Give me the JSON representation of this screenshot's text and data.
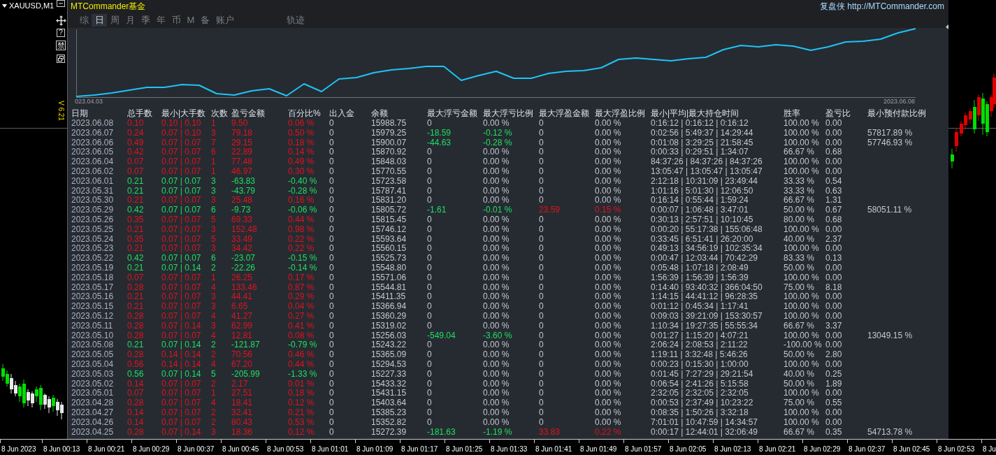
{
  "chart_window": {
    "symbol": "XAUUSD,M1",
    "time_axis": [
      "8 Jun 2023",
      "8 Jun 00:13",
      "8 Jun 00:21",
      "8 Jun 00:29",
      "8 Jun 00:37",
      "8 Jun 00:45",
      "8 Jun 00:53",
      "8 Jun 01:01",
      "8 Jun 01:09",
      "8 Jun 01:17",
      "8 Jun 01:25",
      "8 Jun 01:33",
      "8 Jun 01:41",
      "8 Jun 01:49",
      "8 Jun 01:57",
      "8 Jun 02:05",
      "8 Jun 02:13",
      "8 Jun 02:21",
      "8 Jun 02:29",
      "8 Jun 02:37",
      "8 Jun 02:45",
      "8 Jun 02:53",
      "8 Ju"
    ]
  },
  "side_toolbar": {
    "help_label": "?",
    "ban_label": "禁",
    "version": "V 6.21"
  },
  "panel": {
    "title": "MTCommander基金",
    "link": "复盘侠 http://MTCommander.com",
    "tabs": [
      {
        "label": "综",
        "selected": false
      },
      {
        "label": "日",
        "selected": true
      },
      {
        "label": "周",
        "selected": false
      },
      {
        "label": "月",
        "selected": false
      },
      {
        "label": "季",
        "selected": false
      },
      {
        "label": "年",
        "selected": false
      },
      {
        "label": "币",
        "selected": false
      },
      {
        "label": "M",
        "selected": false
      },
      {
        "label": "备",
        "selected": false
      },
      {
        "label": "账户",
        "selected": false
      }
    ],
    "side_tabs": [
      {
        "label": "轨迹",
        "selected": false
      }
    ],
    "chart": {
      "start_label": "023.04.03",
      "end_label": "2023.06.08"
    }
  },
  "table": {
    "columns": [
      "日期",
      "总手数",
      "最小|大手数",
      "次数",
      "盈亏金额",
      "百分比%",
      "出入金",
      "余额",
      "最大浮亏金额",
      "最大浮亏比例",
      "最大浮盈金额",
      "最大浮盈比例",
      "最小|平均|最大持仓时间",
      "胜率",
      "盈亏比",
      "最小预付款比例"
    ],
    "rows": [
      {
        "cells": [
          "2023.06.08",
          "0.10",
          "0.10 | 0.10",
          "1",
          "9.50",
          "0.06 %",
          "0",
          "15988.75",
          "0",
          "0.00 %",
          "0",
          "0.00 %",
          "0:16:12 | 0:16:12 | 0:16:12",
          "100.00 %",
          "0.00"
        ],
        "profitable": true,
        "floating_loss": false,
        "floating_profit": false
      },
      {
        "cells": [
          "2023.06.07",
          "0.24",
          "0.07 | 0.10",
          "3",
          "79.18",
          "0.50 %",
          "0",
          "15979.25",
          "-18.59",
          "-0.12 %",
          "0",
          "0.00 %",
          "0:02:56 | 5:49:37 | 14:29:44",
          "100.00 %",
          "0.00",
          "57817.89 %"
        ],
        "profitable": true,
        "floating_loss": true,
        "floating_profit": false
      },
      {
        "cells": [
          "2023.06.06",
          "0.49",
          "0.07 | 0.07",
          "7",
          "29.15",
          "0.18 %",
          "0",
          "15900.07",
          "-44.63",
          "-0.28 %",
          "0",
          "0.00 %",
          "0:01:08 | 3:29:25 | 21:58:45",
          "100.00 %",
          "0.00",
          "57746.93 %"
        ],
        "profitable": true,
        "floating_loss": true,
        "floating_profit": false
      },
      {
        "cells": [
          "2023.06.05",
          "0.42",
          "0.07 | 0.07",
          "6",
          "22.89",
          "0.14 %",
          "0",
          "15870.92",
          "0",
          "0.00 %",
          "0",
          "0.00 %",
          "0:00:33 | 0:29:51 | 1:34:07",
          "66.67 %",
          "0.68"
        ],
        "profitable": true,
        "floating_loss": false,
        "floating_profit": false
      },
      {
        "cells": [
          "2023.06.04",
          "0.07",
          "0.07 | 0.07",
          "1",
          "77.48",
          "0.49 %",
          "0",
          "15848.03",
          "0",
          "0.00 %",
          "0",
          "0.00 %",
          "84:37:26 | 84:37:26 | 84:37:26",
          "100.00 %",
          "0.00"
        ],
        "profitable": true,
        "floating_loss": false,
        "floating_profit": false
      },
      {
        "cells": [
          "2023.06.02",
          "0.07",
          "0.07 | 0.07",
          "1",
          "46.97",
          "0.30 %",
          "0",
          "15770.55",
          "0",
          "0.00 %",
          "0",
          "0.00 %",
          "13:05:47 | 13:05:47 | 13:05:47",
          "100.00 %",
          "0.00"
        ],
        "profitable": true,
        "floating_loss": false,
        "floating_profit": false
      },
      {
        "cells": [
          "2023.06.01",
          "0.21",
          "0.07 | 0.07",
          "3",
          "-63.83",
          "-0.40 %",
          "0",
          "15723.58",
          "0",
          "0.00 %",
          "0",
          "0.00 %",
          "2:12:18 | 10:31:09 | 23:49:44",
          "33.33 %",
          "0.54"
        ],
        "profitable": false,
        "floating_loss": false,
        "floating_profit": false
      },
      {
        "cells": [
          "2023.05.31",
          "0.21",
          "0.07 | 0.07",
          "3",
          "-43.79",
          "-0.28 %",
          "0",
          "15787.41",
          "0",
          "0.00 %",
          "0",
          "0.00 %",
          "1:01:16 | 5:01:30 | 12:06:50",
          "33.33 %",
          "0.63"
        ],
        "profitable": false,
        "floating_loss": false,
        "floating_profit": false
      },
      {
        "cells": [
          "2023.05.30",
          "0.21",
          "0.07 | 0.07",
          "3",
          "25.48",
          "0.16 %",
          "0",
          "15831.20",
          "0",
          "0.00 %",
          "0",
          "0.00 %",
          "0:16:14 | 0:55:44 | 1:59:24",
          "66.67 %",
          "1.31"
        ],
        "profitable": true,
        "floating_loss": false,
        "floating_profit": false
      },
      {
        "cells": [
          "2023.05.29",
          "0.42",
          "0.07 | 0.07",
          "6",
          "-9.73",
          "-0.06 %",
          "0",
          "15805.72",
          "-1.61",
          "-0.01 %",
          "23.59",
          "0.15 %",
          "0:00:07 | 1:06:48 | 3:47:01",
          "50.00 %",
          "0.67",
          "58051.11 %"
        ],
        "profitable": false,
        "floating_loss": true,
        "floating_profit": true
      },
      {
        "cells": [
          "2023.05.26",
          "0.35",
          "0.07 | 0.07",
          "5",
          "69.33",
          "0.44 %",
          "0",
          "15815.45",
          "0",
          "0.00 %",
          "0",
          "0.00 %",
          "0:30:13 | 2:57:51 | 10:10:45",
          "80.00 %",
          "0.68"
        ],
        "profitable": true,
        "floating_loss": false,
        "floating_profit": false
      },
      {
        "cells": [
          "2023.05.25",
          "0.21",
          "0.07 | 0.07",
          "3",
          "152.48",
          "0.98 %",
          "0",
          "15746.12",
          "0",
          "0.00 %",
          "0",
          "0.00 %",
          "0:00:20 | 55:17:38 | 155:06:48",
          "100.00 %",
          "0.00"
        ],
        "profitable": true,
        "floating_loss": false,
        "floating_profit": false
      },
      {
        "cells": [
          "2023.05.24",
          "0.35",
          "0.07 | 0.07",
          "5",
          "33.49",
          "0.22 %",
          "0",
          "15593.64",
          "0",
          "0.00 %",
          "0",
          "0.00 %",
          "0:33:45 | 6:51:41 | 26:20:00",
          "40.00 %",
          "2.37"
        ],
        "profitable": true,
        "floating_loss": false,
        "floating_profit": false
      },
      {
        "cells": [
          "2023.05.23",
          "0.21",
          "0.07 | 0.07",
          "3",
          "34.42",
          "0.22 %",
          "0",
          "15560.15",
          "0",
          "0.00 %",
          "0",
          "0.00 %",
          "0:49:13 | 34:56:19 | 102:35:34",
          "100.00 %",
          "0.00"
        ],
        "profitable": true,
        "floating_loss": false,
        "floating_profit": false
      },
      {
        "cells": [
          "2023.05.22",
          "0.42",
          "0.07 | 0.07",
          "6",
          "-23.07",
          "-0.15 %",
          "0",
          "15525.73",
          "0",
          "0.00 %",
          "0",
          "0.00 %",
          "0:00:47 | 12:03:44 | 70:42:29",
          "83.33 %",
          "0.13"
        ],
        "profitable": false,
        "floating_loss": false,
        "floating_profit": false
      },
      {
        "cells": [
          "2023.05.19",
          "0.21",
          "0.07 | 0.14",
          "2",
          "-22.26",
          "-0.14 %",
          "0",
          "15548.80",
          "0",
          "0.00 %",
          "0",
          "0.00 %",
          "0:05:48 | 1:07:18 | 2:08:49",
          "50.00 %",
          "0.00"
        ],
        "profitable": false,
        "floating_loss": false,
        "floating_profit": false
      },
      {
        "cells": [
          "2023.05.18",
          "0.07",
          "0.07 | 0.07",
          "1",
          "26.25",
          "0.17 %",
          "0",
          "15571.06",
          "0",
          "0.00 %",
          "0",
          "0.00 %",
          "1:56:39 | 1:56:39 | 1:56:39",
          "100.00 %",
          "0.00"
        ],
        "profitable": true,
        "floating_loss": false,
        "floating_profit": false
      },
      {
        "cells": [
          "2023.05.17",
          "0.28",
          "0.07 | 0.07",
          "4",
          "133.46",
          "0.87 %",
          "0",
          "15544.81",
          "0",
          "0.00 %",
          "0",
          "0.00 %",
          "0:14:40 | 93:40:32 | 366:04:50",
          "75.00 %",
          "8.18"
        ],
        "profitable": true,
        "floating_loss": false,
        "floating_profit": false
      },
      {
        "cells": [
          "2023.05.16",
          "0.21",
          "0.07 | 0.07",
          "3",
          "44.41",
          "0.29 %",
          "0",
          "15411.35",
          "0",
          "0.00 %",
          "0",
          "0.00 %",
          "1:14:15 | 44:41:12 | 96:28:35",
          "100.00 %",
          "0.00"
        ],
        "profitable": true,
        "floating_loss": false,
        "floating_profit": false
      },
      {
        "cells": [
          "2023.05.15",
          "0.21",
          "0.07 | 0.07",
          "3",
          "6.65",
          "0.04 %",
          "0",
          "15366.94",
          "0",
          "0.00 %",
          "0",
          "0.00 %",
          "0:01:12 | 0:45:34 | 1:17:41",
          "100.00 %",
          "0.00"
        ],
        "profitable": true,
        "floating_loss": false,
        "floating_profit": false
      },
      {
        "cells": [
          "2023.05.12",
          "0.28",
          "0.07 | 0.07",
          "4",
          "41.27",
          "0.27 %",
          "0",
          "15360.29",
          "0",
          "0.00 %",
          "0",
          "0.00 %",
          "0:09:03 | 39:21:09 | 153:30:57",
          "100.00 %",
          "0.00"
        ],
        "profitable": true,
        "floating_loss": false,
        "floating_profit": false
      },
      {
        "cells": [
          "2023.05.11",
          "0.28",
          "0.07 | 0.14",
          "3",
          "62.99",
          "0.41 %",
          "0",
          "15319.02",
          "0",
          "0.00 %",
          "0",
          "0.00 %",
          "1:10:34 | 19:27:35 | 55:55:34",
          "66.67 %",
          "3.37"
        ],
        "profitable": true,
        "floating_loss": false,
        "floating_profit": false
      },
      {
        "cells": [
          "2023.05.10",
          "0.28",
          "0.07 | 0.07",
          "4",
          "12.81",
          "0.08 %",
          "0",
          "15256.03",
          "-549.04",
          "-3.60 %",
          "0",
          "0.00 %",
          "0:01:27 | 1:15:20 | 4:07:21",
          "100.00 %",
          "0.00",
          "13049.15 %"
        ],
        "profitable": true,
        "floating_loss": true,
        "floating_profit": false
      },
      {
        "cells": [
          "2023.05.08",
          "0.21",
          "0.07 | 0.14",
          "2",
          "-121.87",
          "-0.79 %",
          "0",
          "15243.22",
          "0",
          "0.00 %",
          "0",
          "0.00 %",
          "2:06:24 | 2:08:53 | 2:11:22",
          "-100.00 %",
          "0.00"
        ],
        "profitable": false,
        "floating_loss": false,
        "floating_profit": false
      },
      {
        "cells": [
          "2023.05.05",
          "0.28",
          "0.14 | 0.14",
          "2",
          "70.56",
          "0.46 %",
          "0",
          "15365.09",
          "0",
          "0.00 %",
          "0",
          "0.00 %",
          "1:19:11 | 3:32:48 | 5:46:26",
          "50.00 %",
          "2.80"
        ],
        "profitable": true,
        "floating_loss": false,
        "floating_profit": false
      },
      {
        "cells": [
          "2023.05.04",
          "0.56",
          "0.14 | 0.14",
          "4",
          "67.20",
          "0.44 %",
          "0",
          "15294.53",
          "0",
          "0.00 %",
          "0",
          "0.00 %",
          "0:00:23 | 0:15:30 | 1:00:00",
          "100.00 %",
          "0.00"
        ],
        "profitable": true,
        "floating_loss": false,
        "floating_profit": false
      },
      {
        "cells": [
          "2023.05.03",
          "0.56",
          "0.07 | 0.14",
          "5",
          "-205.99",
          "-1.33 %",
          "0",
          "15227.33",
          "0",
          "0.00 %",
          "0",
          "0.00 %",
          "0:01:45 | 7:27:29 | 29:21:54",
          "40.00 %",
          "0.25"
        ],
        "profitable": false,
        "floating_loss": false,
        "floating_profit": false
      },
      {
        "cells": [
          "2023.05.02",
          "0.14",
          "0.07 | 0.07",
          "2",
          "2.17",
          "0.01 %",
          "0",
          "15433.32",
          "0",
          "0.00 %",
          "0",
          "0.00 %",
          "0:06:54 | 2:41:26 | 5:15:58",
          "50.00 %",
          "1.89"
        ],
        "profitable": true,
        "floating_loss": false,
        "floating_profit": false
      },
      {
        "cells": [
          "2023.05.01",
          "0.07",
          "0.07 | 0.07",
          "1",
          "27.51",
          "0.18 %",
          "0",
          "15431.15",
          "0",
          "0.00 %",
          "0",
          "0.00 %",
          "2:32:05 | 2:32:05 | 2:32:05",
          "100.00 %",
          "0.00"
        ],
        "profitable": true,
        "floating_loss": false,
        "floating_profit": false
      },
      {
        "cells": [
          "2023.04.28",
          "0.28",
          "0.07 | 0.07",
          "4",
          "18.41",
          "0.12 %",
          "0",
          "15403.64",
          "0",
          "0.00 %",
          "0",
          "0.00 %",
          "0:00:53 | 2:37:49 | 10:23:22",
          "75.00 %",
          "0.55"
        ],
        "profitable": true,
        "floating_loss": false,
        "floating_profit": false
      },
      {
        "cells": [
          "2023.04.27",
          "0.14",
          "0.07 | 0.07",
          "2",
          "32.41",
          "0.21 %",
          "0",
          "15385.23",
          "0",
          "0.00 %",
          "0",
          "0.00 %",
          "0:08:35 | 1:50:26 | 3:32:18",
          "100.00 %",
          "0.00"
        ],
        "profitable": true,
        "floating_loss": false,
        "floating_profit": false
      },
      {
        "cells": [
          "2023.04.26",
          "0.14",
          "0.07 | 0.07",
          "2",
          "80.43",
          "0.53 %",
          "0",
          "15352.82",
          "0",
          "0.00 %",
          "0",
          "0.00 %",
          "7:01:01 | 10:47:59 | 14:34:57",
          "100.00 %",
          "0.00"
        ],
        "profitable": true,
        "floating_loss": false,
        "floating_profit": false
      },
      {
        "cells": [
          "2023.04.25",
          "0.28",
          "0.07 | 0.14",
          "3",
          "18.36",
          "0.12 %",
          "0",
          "15272.39",
          "-181.63",
          "-1.19 %",
          "33.83",
          "0.22 %",
          "0:00:17 | 12:44:01 | 32:06:49",
          "66.67 %",
          "0.35",
          "54713.78 %"
        ],
        "profitable": true,
        "floating_loss": true,
        "floating_profit": true
      }
    ]
  }
}
